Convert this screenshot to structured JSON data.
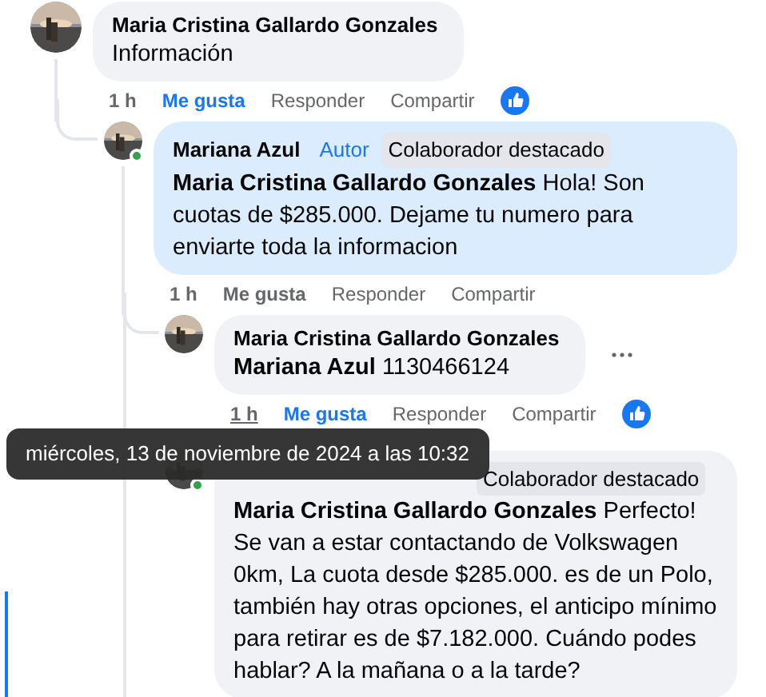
{
  "comments": [
    {
      "author": "Maria Cristina Gallardo Gonzales",
      "online": false,
      "highlighted": false,
      "text": "Información",
      "actions": {
        "time": "1 h",
        "time_hovered": false,
        "like": "Me gusta",
        "liked": true,
        "reply": "Responder",
        "share": "Compartir",
        "reaction_shown": true
      },
      "children": [
        {
          "author": "Mariana Azul",
          "online": true,
          "highlighted": true,
          "badges": [
            {
              "label": "Autor",
              "kind": "author"
            },
            {
              "label": "Colaborador destacado",
              "kind": "featured"
            }
          ],
          "mention": "Maria Cristina Gallardo Gonzales",
          "text": "Hola! Son cuotas de $285.000. Dejame tu numero para enviarte toda la informacion",
          "actions": {
            "time": "1 h",
            "time_hovered": false,
            "like": "Me gusta",
            "liked": false,
            "reply": "Responder",
            "share": "Compartir",
            "reaction_shown": false
          },
          "children": [
            {
              "author": "Maria Cristina Gallardo Gonzales",
              "online": false,
              "highlighted": false,
              "mention": "Mariana Azul",
              "text": "1130466124",
              "menu_shown": true,
              "actions": {
                "time": "1 h",
                "time_hovered": true,
                "like": "Me gusta",
                "liked": true,
                "reply": "Responder",
                "share": "Compartir",
                "reaction_shown": true
              }
            },
            {
              "online": true,
              "highlighted": false,
              "badges": [
                {
                  "label": "Colaborador destacado",
                  "kind": "featured"
                }
              ],
              "mention": "Maria Cristina Gallardo Gonzales",
              "text": "Perfecto! Se van a estar contactando de Volkswagen 0km, La cuota desde $285.000. es de un Polo, también hay otras opciones, el anticipo mínimo para retirar es de $7.182.000. Cuándo podes hablar? A la mañana o a la tarde?"
            }
          ]
        }
      ]
    }
  ],
  "tooltip": {
    "text": "miércoles, 13 de noviembre de 2024 a las 10:32"
  }
}
